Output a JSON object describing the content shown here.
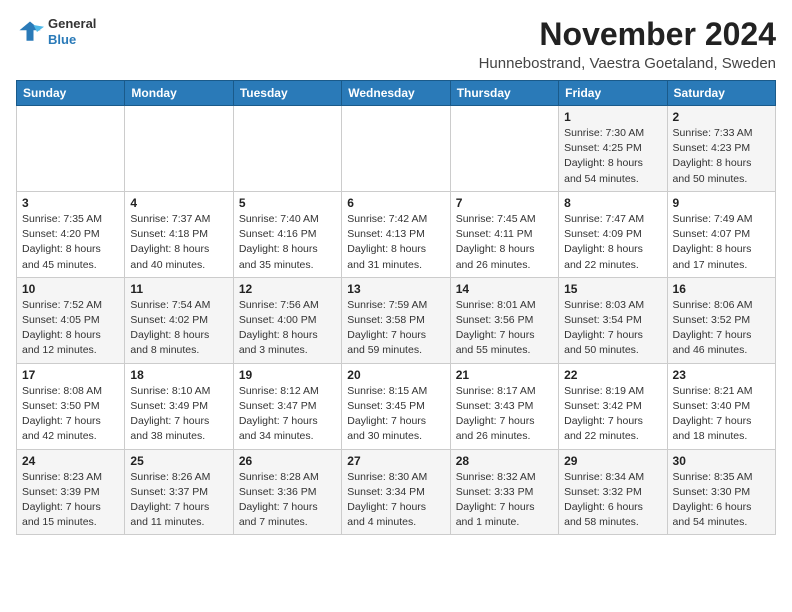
{
  "header": {
    "logo_line1": "General",
    "logo_line2": "Blue",
    "month_title": "November 2024",
    "subtitle": "Hunnebostrand, Vaestra Goetaland, Sweden"
  },
  "weekdays": [
    "Sunday",
    "Monday",
    "Tuesday",
    "Wednesday",
    "Thursday",
    "Friday",
    "Saturday"
  ],
  "weeks": [
    [
      {
        "day": "",
        "info": ""
      },
      {
        "day": "",
        "info": ""
      },
      {
        "day": "",
        "info": ""
      },
      {
        "day": "",
        "info": ""
      },
      {
        "day": "",
        "info": ""
      },
      {
        "day": "1",
        "info": "Sunrise: 7:30 AM\nSunset: 4:25 PM\nDaylight: 8 hours\nand 54 minutes."
      },
      {
        "day": "2",
        "info": "Sunrise: 7:33 AM\nSunset: 4:23 PM\nDaylight: 8 hours\nand 50 minutes."
      }
    ],
    [
      {
        "day": "3",
        "info": "Sunrise: 7:35 AM\nSunset: 4:20 PM\nDaylight: 8 hours\nand 45 minutes."
      },
      {
        "day": "4",
        "info": "Sunrise: 7:37 AM\nSunset: 4:18 PM\nDaylight: 8 hours\nand 40 minutes."
      },
      {
        "day": "5",
        "info": "Sunrise: 7:40 AM\nSunset: 4:16 PM\nDaylight: 8 hours\nand 35 minutes."
      },
      {
        "day": "6",
        "info": "Sunrise: 7:42 AM\nSunset: 4:13 PM\nDaylight: 8 hours\nand 31 minutes."
      },
      {
        "day": "7",
        "info": "Sunrise: 7:45 AM\nSunset: 4:11 PM\nDaylight: 8 hours\nand 26 minutes."
      },
      {
        "day": "8",
        "info": "Sunrise: 7:47 AM\nSunset: 4:09 PM\nDaylight: 8 hours\nand 22 minutes."
      },
      {
        "day": "9",
        "info": "Sunrise: 7:49 AM\nSunset: 4:07 PM\nDaylight: 8 hours\nand 17 minutes."
      }
    ],
    [
      {
        "day": "10",
        "info": "Sunrise: 7:52 AM\nSunset: 4:05 PM\nDaylight: 8 hours\nand 12 minutes."
      },
      {
        "day": "11",
        "info": "Sunrise: 7:54 AM\nSunset: 4:02 PM\nDaylight: 8 hours\nand 8 minutes."
      },
      {
        "day": "12",
        "info": "Sunrise: 7:56 AM\nSunset: 4:00 PM\nDaylight: 8 hours\nand 3 minutes."
      },
      {
        "day": "13",
        "info": "Sunrise: 7:59 AM\nSunset: 3:58 PM\nDaylight: 7 hours\nand 59 minutes."
      },
      {
        "day": "14",
        "info": "Sunrise: 8:01 AM\nSunset: 3:56 PM\nDaylight: 7 hours\nand 55 minutes."
      },
      {
        "day": "15",
        "info": "Sunrise: 8:03 AM\nSunset: 3:54 PM\nDaylight: 7 hours\nand 50 minutes."
      },
      {
        "day": "16",
        "info": "Sunrise: 8:06 AM\nSunset: 3:52 PM\nDaylight: 7 hours\nand 46 minutes."
      }
    ],
    [
      {
        "day": "17",
        "info": "Sunrise: 8:08 AM\nSunset: 3:50 PM\nDaylight: 7 hours\nand 42 minutes."
      },
      {
        "day": "18",
        "info": "Sunrise: 8:10 AM\nSunset: 3:49 PM\nDaylight: 7 hours\nand 38 minutes."
      },
      {
        "day": "19",
        "info": "Sunrise: 8:12 AM\nSunset: 3:47 PM\nDaylight: 7 hours\nand 34 minutes."
      },
      {
        "day": "20",
        "info": "Sunrise: 8:15 AM\nSunset: 3:45 PM\nDaylight: 7 hours\nand 30 minutes."
      },
      {
        "day": "21",
        "info": "Sunrise: 8:17 AM\nSunset: 3:43 PM\nDaylight: 7 hours\nand 26 minutes."
      },
      {
        "day": "22",
        "info": "Sunrise: 8:19 AM\nSunset: 3:42 PM\nDaylight: 7 hours\nand 22 minutes."
      },
      {
        "day": "23",
        "info": "Sunrise: 8:21 AM\nSunset: 3:40 PM\nDaylight: 7 hours\nand 18 minutes."
      }
    ],
    [
      {
        "day": "24",
        "info": "Sunrise: 8:23 AM\nSunset: 3:39 PM\nDaylight: 7 hours\nand 15 minutes."
      },
      {
        "day": "25",
        "info": "Sunrise: 8:26 AM\nSunset: 3:37 PM\nDaylight: 7 hours\nand 11 minutes."
      },
      {
        "day": "26",
        "info": "Sunrise: 8:28 AM\nSunset: 3:36 PM\nDaylight: 7 hours\nand 7 minutes."
      },
      {
        "day": "27",
        "info": "Sunrise: 8:30 AM\nSunset: 3:34 PM\nDaylight: 7 hours\nand 4 minutes."
      },
      {
        "day": "28",
        "info": "Sunrise: 8:32 AM\nSunset: 3:33 PM\nDaylight: 7 hours\nand 1 minute."
      },
      {
        "day": "29",
        "info": "Sunrise: 8:34 AM\nSunset: 3:32 PM\nDaylight: 6 hours\nand 58 minutes."
      },
      {
        "day": "30",
        "info": "Sunrise: 8:35 AM\nSunset: 3:30 PM\nDaylight: 6 hours\nand 54 minutes."
      }
    ]
  ]
}
